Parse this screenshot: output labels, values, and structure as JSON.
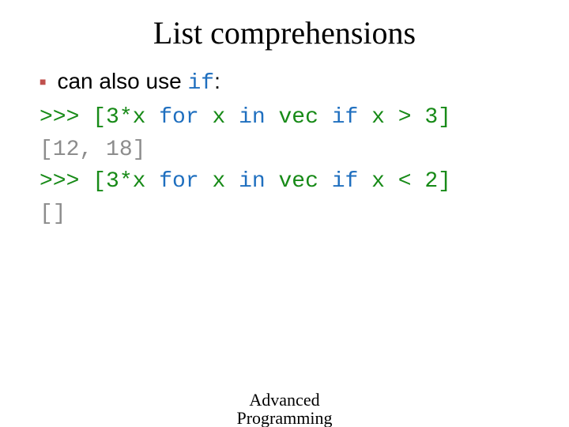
{
  "title": "List comprehensions",
  "bullet": {
    "pre": "can also use ",
    "kw": "if",
    "post": ":"
  },
  "code": {
    "l1": {
      "prompt": ">>> ",
      "a": "[3*x ",
      "kw": "for",
      "b": " x ",
      "kw2": "in",
      "c": " vec ",
      "kw3": "if",
      "d": " x > 3]"
    },
    "l2": "[12, 18]",
    "l3": {
      "prompt": ">>> ",
      "a": "[3*x ",
      "kw": "for",
      "b": " x ",
      "kw2": "in",
      "c": " vec ",
      "kw3": "if",
      "d": " x < 2]"
    },
    "l4": "[]"
  },
  "footer": {
    "line1": "Advanced",
    "line2": "Programming"
  }
}
